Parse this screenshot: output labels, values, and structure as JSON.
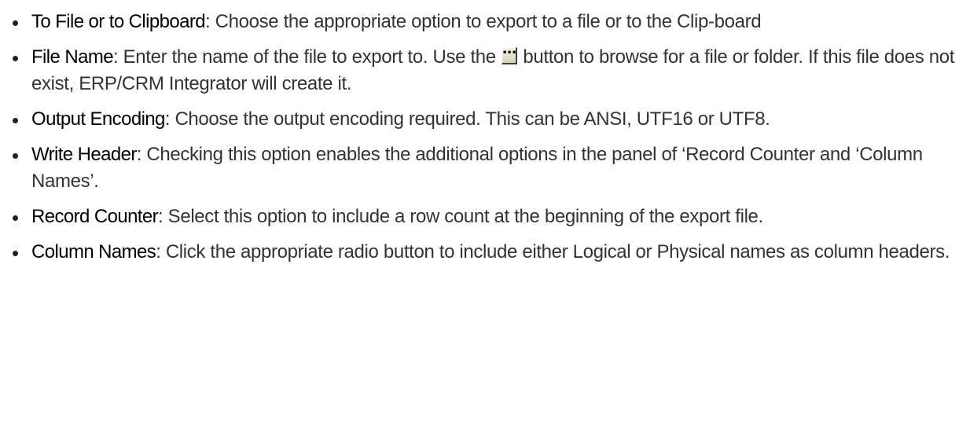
{
  "items": [
    {
      "term": "To File or to Clipboard",
      "separator": ": ",
      "text": "Choose the appropriate option to export to a file or to the Clip-­board"
    },
    {
      "term": "File Name",
      "separator": ": ",
      "text_before": "Enter the name of the file to export to. Use the ",
      "button_icon": "ellipsis-browse-icon",
      "button_glyph": "…",
      "text_after": " button to browse for a file or folder. If this file does not exist, ERP/CRM Integrator will create it."
    },
    {
      "term": "Output Encoding",
      "separator": ": ",
      "text": "Choose the output encoding required.  This can be ANSI, UTF16 or UTF8."
    },
    {
      "term": "Write Header",
      "separator": ": ",
      "text": "Checking this option enables the additional options in the panel of ‘Record Counter and ‘Column Names’."
    },
    {
      "term": "Record Counter",
      "separator": ": ",
      "text": "Select this option to include a row count at the beginning of the export file."
    },
    {
      "term": "Column Names",
      "separator": ": ",
      "text": "Click the appropriate radio button to include either Logical or Physical names as column headers."
    }
  ]
}
